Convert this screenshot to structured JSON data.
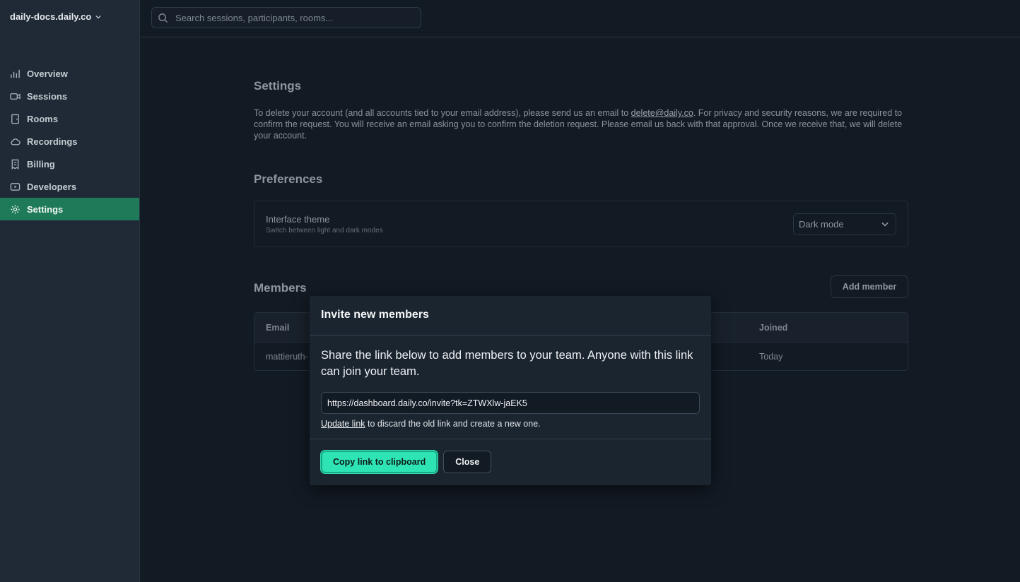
{
  "workspace": {
    "name": "daily-docs.daily.co"
  },
  "search": {
    "placeholder": "Search sessions, participants, rooms..."
  },
  "sidebar": {
    "items": [
      {
        "label": "Overview",
        "icon": "bar-chart-icon",
        "active": false
      },
      {
        "label": "Sessions",
        "icon": "video-camera-icon",
        "active": false
      },
      {
        "label": "Rooms",
        "icon": "door-icon",
        "active": false
      },
      {
        "label": "Recordings",
        "icon": "cloud-icon",
        "active": false
      },
      {
        "label": "Billing",
        "icon": "receipt-icon",
        "active": false
      },
      {
        "label": "Developers",
        "icon": "play-rectangle-icon",
        "active": false
      },
      {
        "label": "Settings",
        "icon": "gear-icon",
        "active": true
      }
    ]
  },
  "settings": {
    "title": "Settings",
    "delete_text_before": "To delete your account (and all accounts tied to your email address), please send us an email to ",
    "delete_email": "delete@daily.co",
    "delete_text_after": ". For privacy and security reasons, we are required to confirm the request. You will receive an email asking you to confirm the deletion request. Please email us back with that approval. Once we receive that, we will delete your account."
  },
  "preferences": {
    "title": "Preferences",
    "theme_label": "Interface theme",
    "theme_sub": "Switch between light and dark modes",
    "theme_value": "Dark mode"
  },
  "members": {
    "title": "Members",
    "add_button": "Add member",
    "columns": {
      "email": "Email",
      "joined": "Joined"
    },
    "rows": [
      {
        "email": "mattieruth-",
        "joined": "Today"
      }
    ]
  },
  "modal": {
    "title": "Invite new members",
    "text": "Share the link below to add members to your team. Anyone with this link can join your team.",
    "link": "https://dashboard.daily.co/invite?tk=ZTWXlw-jaEK5",
    "update_link": "Update link",
    "update_suffix": " to discard the old link and create a new one.",
    "copy_button": "Copy link to clipboard",
    "close_button": "Close"
  },
  "colors": {
    "accent": "#2ee3b4",
    "active_nav": "#1f7a5a",
    "background": "#121a23",
    "sidebar": "#1f2a36"
  }
}
